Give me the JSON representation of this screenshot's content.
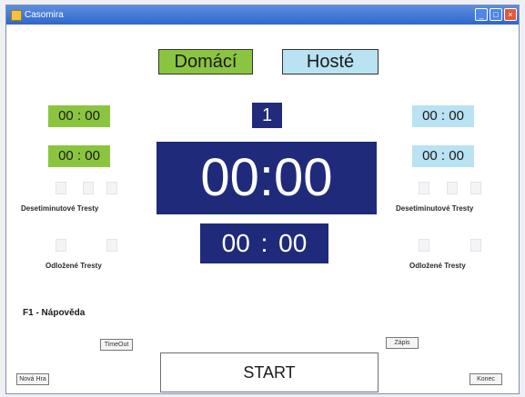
{
  "window": {
    "title": "Casomira"
  },
  "teams": {
    "home_label": "Domácí",
    "guest_label": "Hosté"
  },
  "period": "1",
  "penalties": {
    "home": [
      "00 : 00",
      "00 : 00"
    ],
    "guest": [
      "00 : 00",
      "00 : 00"
    ]
  },
  "main_clock": "00:00",
  "sub_clock": "00 : 00",
  "labels": {
    "ten_min_penalties": "Desetiminutové Tresty",
    "delayed_penalties": "Odložené Tresty",
    "help": "F1 - Nápověda"
  },
  "buttons": {
    "timeout": "TimeOut",
    "record": "Zápis",
    "new_game": "Nová Hra",
    "start": "START",
    "end": "Konec"
  },
  "colors": {
    "home": "#8bc53f",
    "guest": "#b9e2f2",
    "clock": "#1f2a7a"
  }
}
